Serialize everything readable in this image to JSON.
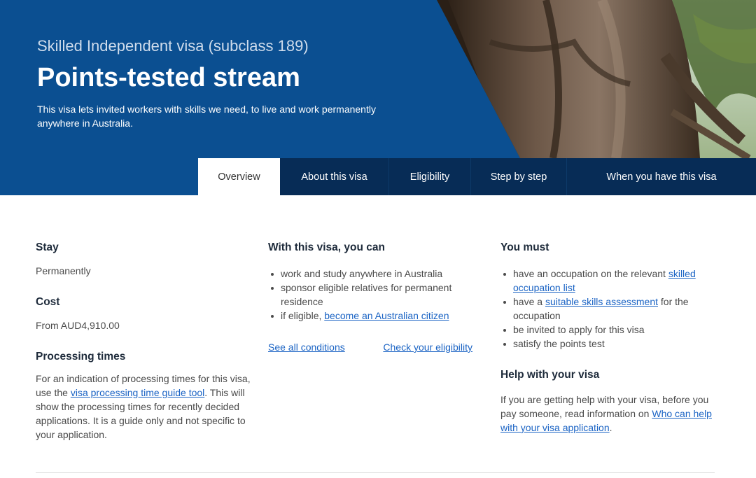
{
  "hero": {
    "subtitle": "Skilled Independent visa (subclass 189)",
    "title": "Points-tested stream",
    "intro": "This visa lets invited workers with skills we need, to live and work permanently anywhere in Australia."
  },
  "tabs": [
    {
      "label": "Overview"
    },
    {
      "label": "About this visa"
    },
    {
      "label": "Eligibility"
    },
    {
      "label": "Step by step"
    },
    {
      "label": "When you have this visa"
    }
  ],
  "stay": {
    "heading": "Stay",
    "value": "Permanently"
  },
  "cost": {
    "heading": "Cost",
    "value": "From AUD4,910.00"
  },
  "processing": {
    "heading": "Processing times",
    "text_before": "For an indication of processing times for this visa, use the ",
    "link": "visa processing time guide tool",
    "text_after": ". This will show the processing times for recently decided applications. It is a guide only and not specific to your application."
  },
  "can": {
    "heading": "With this visa, you can",
    "item1": "work and study anywhere in Australia",
    "item2": "sponsor eligible relatives for permanent residence",
    "item3_text": "if eligible, ",
    "item3_link": "become an Australian citizen",
    "see_all": "See all conditions",
    "check": "Check your eligibility"
  },
  "must": {
    "heading": "You must",
    "item1_text": "have an occupation on the relevant ",
    "item1_link": "skilled occupation list",
    "item2_text": "have a ",
    "item2_link": "suitable skills assessment",
    "item2_after": " for the occupation",
    "item3": "be invited to apply for this visa",
    "item4": "satisfy the points test"
  },
  "help": {
    "heading": "Help with your visa",
    "text_before": "If you are getting help with your visa, before you pay someone, read information on ",
    "link": "Who can help with your visa application",
    "text_after": "."
  },
  "colors": {
    "hero_blue": "#0b4f91",
    "tab_navy": "#072c56",
    "link_blue": "#1a63c4"
  }
}
